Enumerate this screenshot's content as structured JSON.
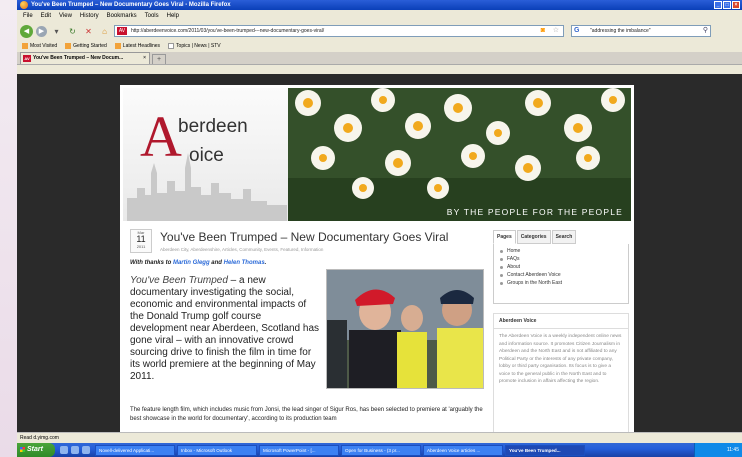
{
  "window": {
    "title": "You've Been Trumped – New Documentary Goes Viral - Mozilla Firefox"
  },
  "menu": [
    "File",
    "Edit",
    "View",
    "History",
    "Bookmarks",
    "Tools",
    "Help"
  ],
  "nav": {
    "url": "http://aberdeenvoice.com/2011/03/you've-been-trumped---new-documentary-goes-viral/",
    "search_value": "\"addressing the imbalance\""
  },
  "bookmarks": [
    "Most Visited",
    "Getting Started",
    "Latest Headlines",
    "Topics | News | STV"
  ],
  "tab": {
    "label": "You've Been Trumped – New Docum..."
  },
  "site": {
    "logo_line1": "berdeen",
    "logo_line2": "oice",
    "logo_letter": "A",
    "tagline": "BY THE PEOPLE FOR THE PEOPLE"
  },
  "post": {
    "month": "Mar",
    "day": "11",
    "year": "2011",
    "title": "You've Been Trumped – New Documentary Goes Viral",
    "meta": "Aberdeen City, Aberdeenshire, Articles, Community, Events, Featured, Information",
    "thanks_prefix": "With thanks to ",
    "author1": "Martin Glegg",
    "thanks_and": " and ",
    "author2": "Helen Thomas",
    "thanks_suffix": ".",
    "lead_em": "You've Been Trumped",
    "lead_rest": " – a new documentary investigating the social, economic and environmental impacts of the Donald Trump golf course development near Aberdeen, Scotland has gone viral – with an innovative crowd sourcing drive to finish the film in time for its world premiere at the beginning of May 2011.",
    "body": "The feature length film, which includes music from Jonsi, the lead singer of Sigur Ros, has been selected to premiere at 'arguably the best showcase in the world for documentary', according to its production team"
  },
  "sidebar": {
    "tabs": [
      "Pages",
      "Categories",
      "Search"
    ],
    "pages": [
      "Home",
      "FAQs",
      "About",
      "Contact Aberdeen Voice",
      "Groups in the North East"
    ],
    "box_title": "Aberdeen Voice",
    "box_text": "The Aberdeen Voice is a weekly independent online news and information source. It promotes Citizen Journalism in Aberdeen and the North East and is not affiliated to any Political Party or the interests of any private company, lobby or third party organisation. Its focus is to give a voice to the general public in the North East and to promote inclusion in affairs affecting the region."
  },
  "status": {
    "text": "Read d.yimg.com"
  },
  "taskbar": {
    "start": "Start",
    "tasks": [
      "Novell-delivered Applicati...",
      "Inbox - Microsoft Outlook",
      "Microsoft PowerPoint - [...",
      "Open for Business - (3 pr...",
      "Aberdeen Voice articles ...",
      "You've Been Trumped..."
    ],
    "clock": "11:45"
  }
}
